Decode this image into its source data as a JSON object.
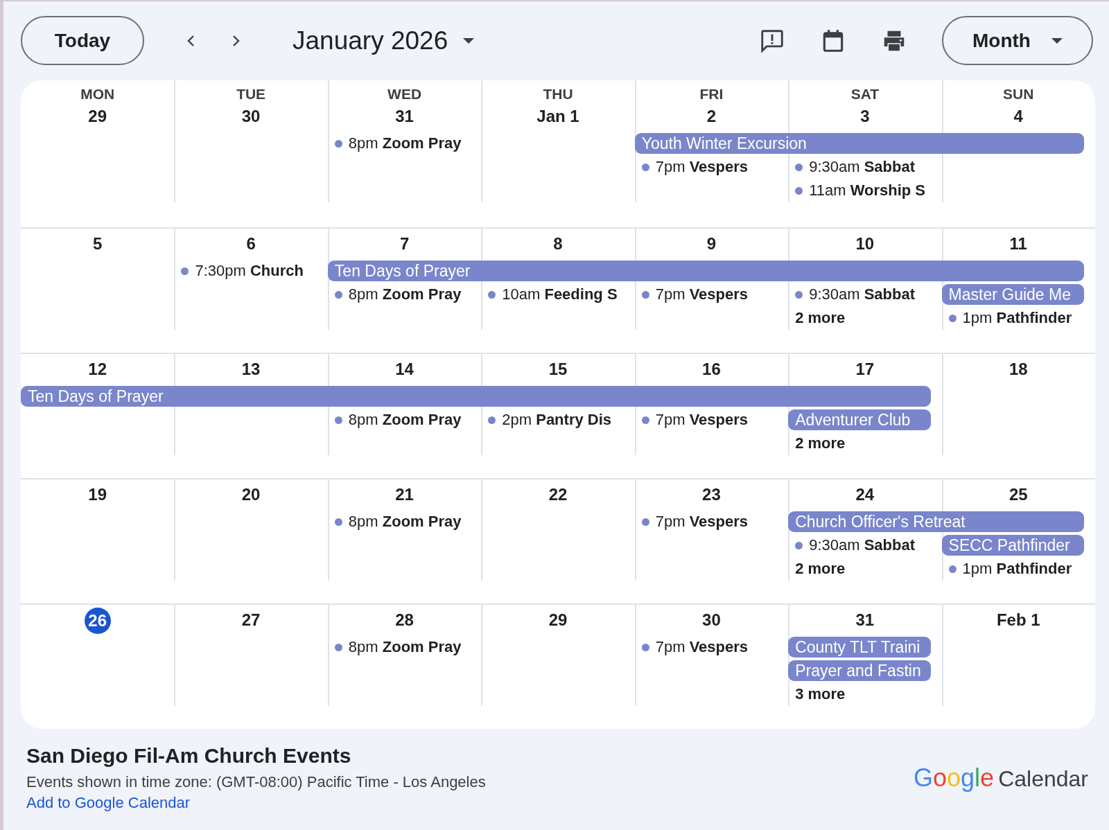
{
  "toolbar": {
    "today_button": "Today",
    "title": "January 2026",
    "view_button": "Month"
  },
  "calendar": {
    "weekdays": [
      "MON",
      "TUE",
      "WED",
      "THU",
      "FRI",
      "SAT",
      "SUN"
    ],
    "weeks": [
      {
        "days": [
          {
            "date": "29",
            "today": false
          },
          {
            "date": "30",
            "today": false
          },
          {
            "date": "31",
            "today": false
          },
          {
            "date": "Jan 1",
            "today": false
          },
          {
            "date": "2",
            "today": false
          },
          {
            "date": "3",
            "today": false
          },
          {
            "date": "4",
            "today": false
          }
        ],
        "lanes": [
          [
            {
              "kind": "none"
            },
            {
              "kind": "none"
            },
            {
              "kind": "timed",
              "text": "8pm **Zoom Pray**"
            },
            {
              "kind": "none"
            },
            {
              "kind": "bar",
              "text": "Youth Winter Excursion"
            },
            {
              "kind": "continue"
            },
            {
              "kind": "continue"
            }
          ],
          [
            {
              "kind": "none"
            },
            {
              "kind": "none"
            },
            {
              "kind": "none"
            },
            {
              "kind": "none"
            },
            {
              "kind": "timed",
              "text": "7pm **Vespers**"
            },
            {
              "kind": "timed",
              "text": "9:30am **Sabbat**"
            },
            {
              "kind": "none"
            }
          ],
          [
            {
              "kind": "none"
            },
            {
              "kind": "none"
            },
            {
              "kind": "none"
            },
            {
              "kind": "none"
            },
            {
              "kind": "none"
            },
            {
              "kind": "timed",
              "text": "11am **Worship S**"
            },
            {
              "kind": "none"
            }
          ]
        ]
      },
      {
        "days": [
          {
            "date": "5",
            "today": false
          },
          {
            "date": "6",
            "today": false
          },
          {
            "date": "7",
            "today": false
          },
          {
            "date": "8",
            "today": false
          },
          {
            "date": "9",
            "today": false
          },
          {
            "date": "10",
            "today": false
          },
          {
            "date": "11",
            "today": false
          }
        ],
        "lanes": [
          [
            {
              "kind": "none"
            },
            {
              "kind": "timed",
              "text": "7:30pm **Church**"
            },
            {
              "kind": "bar",
              "text": "Ten Days of Prayer"
            },
            {
              "kind": "continue"
            },
            {
              "kind": "continue"
            },
            {
              "kind": "continue"
            },
            {
              "kind": "continue"
            }
          ],
          [
            {
              "kind": "none"
            },
            {
              "kind": "none"
            },
            {
              "kind": "timed",
              "text": "8pm **Zoom Pray**"
            },
            {
              "kind": "timed",
              "text": "10am **Feeding S**"
            },
            {
              "kind": "timed",
              "text": "7pm **Vespers**"
            },
            {
              "kind": "timed",
              "text": "9:30am **Sabbat**"
            },
            {
              "kind": "bar",
              "text": "Master Guide Me"
            }
          ],
          [
            {
              "kind": "none"
            },
            {
              "kind": "none"
            },
            {
              "kind": "none"
            },
            {
              "kind": "none"
            },
            {
              "kind": "none"
            },
            {
              "kind": "more",
              "text": "2 more"
            },
            {
              "kind": "timed",
              "text": "1pm **Pathfinder**"
            }
          ]
        ]
      },
      {
        "days": [
          {
            "date": "12",
            "today": false
          },
          {
            "date": "13",
            "today": false
          },
          {
            "date": "14",
            "today": false
          },
          {
            "date": "15",
            "today": false
          },
          {
            "date": "16",
            "today": false
          },
          {
            "date": "17",
            "today": false
          },
          {
            "date": "18",
            "today": false
          }
        ],
        "lanes": [
          [
            {
              "kind": "bar",
              "text": "Ten Days of Prayer"
            },
            {
              "kind": "continue"
            },
            {
              "kind": "continue"
            },
            {
              "kind": "continue"
            },
            {
              "kind": "continue"
            },
            {
              "kind": "continue"
            },
            {
              "kind": "none"
            }
          ],
          [
            {
              "kind": "none"
            },
            {
              "kind": "none"
            },
            {
              "kind": "timed",
              "text": "8pm **Zoom Pray**"
            },
            {
              "kind": "timed",
              "text": "2pm **Pantry Dis**"
            },
            {
              "kind": "timed",
              "text": "7pm **Vespers**"
            },
            {
              "kind": "bar",
              "text": "Adventurer Club"
            },
            {
              "kind": "none"
            }
          ],
          [
            {
              "kind": "none"
            },
            {
              "kind": "none"
            },
            {
              "kind": "none"
            },
            {
              "kind": "none"
            },
            {
              "kind": "none"
            },
            {
              "kind": "more",
              "text": "2 more"
            },
            {
              "kind": "none"
            }
          ]
        ]
      },
      {
        "days": [
          {
            "date": "19",
            "today": false
          },
          {
            "date": "20",
            "today": false
          },
          {
            "date": "21",
            "today": false
          },
          {
            "date": "22",
            "today": false
          },
          {
            "date": "23",
            "today": false
          },
          {
            "date": "24",
            "today": false
          },
          {
            "date": "25",
            "today": false
          }
        ],
        "lanes": [
          [
            {
              "kind": "none"
            },
            {
              "kind": "none"
            },
            {
              "kind": "timed",
              "text": "8pm **Zoom Pray**"
            },
            {
              "kind": "none"
            },
            {
              "kind": "timed",
              "text": "7pm **Vespers**"
            },
            {
              "kind": "bar",
              "text": "Church Officer's Retreat"
            },
            {
              "kind": "continue"
            }
          ],
          [
            {
              "kind": "none"
            },
            {
              "kind": "none"
            },
            {
              "kind": "none"
            },
            {
              "kind": "none"
            },
            {
              "kind": "none"
            },
            {
              "kind": "timed",
              "text": "9:30am **Sabbat**"
            },
            {
              "kind": "bar",
              "text": "SECC Pathfinder"
            }
          ],
          [
            {
              "kind": "none"
            },
            {
              "kind": "none"
            },
            {
              "kind": "none"
            },
            {
              "kind": "none"
            },
            {
              "kind": "none"
            },
            {
              "kind": "more",
              "text": "2 more"
            },
            {
              "kind": "timed",
              "text": "1pm **Pathfinder**"
            }
          ]
        ]
      },
      {
        "days": [
          {
            "date": "26",
            "today": true
          },
          {
            "date": "27",
            "today": false
          },
          {
            "date": "28",
            "today": false
          },
          {
            "date": "29",
            "today": false
          },
          {
            "date": "30",
            "today": false
          },
          {
            "date": "31",
            "today": false
          },
          {
            "date": "Feb 1",
            "today": false
          }
        ],
        "lanes": [
          [
            {
              "kind": "none"
            },
            {
              "kind": "none"
            },
            {
              "kind": "timed",
              "text": "8pm **Zoom Pray**"
            },
            {
              "kind": "none"
            },
            {
              "kind": "timed",
              "text": "7pm **Vespers**"
            },
            {
              "kind": "bar",
              "text": "County TLT Traini"
            },
            {
              "kind": "none"
            }
          ],
          [
            {
              "kind": "none"
            },
            {
              "kind": "none"
            },
            {
              "kind": "none"
            },
            {
              "kind": "none"
            },
            {
              "kind": "none"
            },
            {
              "kind": "bar",
              "text": "Prayer and Fastin"
            },
            {
              "kind": "none"
            }
          ],
          [
            {
              "kind": "none"
            },
            {
              "kind": "none"
            },
            {
              "kind": "none"
            },
            {
              "kind": "none"
            },
            {
              "kind": "none"
            },
            {
              "kind": "more",
              "text": "3 more"
            },
            {
              "kind": "none"
            }
          ]
        ]
      }
    ]
  },
  "footer": {
    "title": "San Diego Fil-Am Church Events",
    "timezone": "Events shown in time zone: (GMT-08:00) Pacific Time - Los Angeles",
    "link": "Add to Google Calendar",
    "logo_word": "Google",
    "logo_product": "Calendar"
  }
}
